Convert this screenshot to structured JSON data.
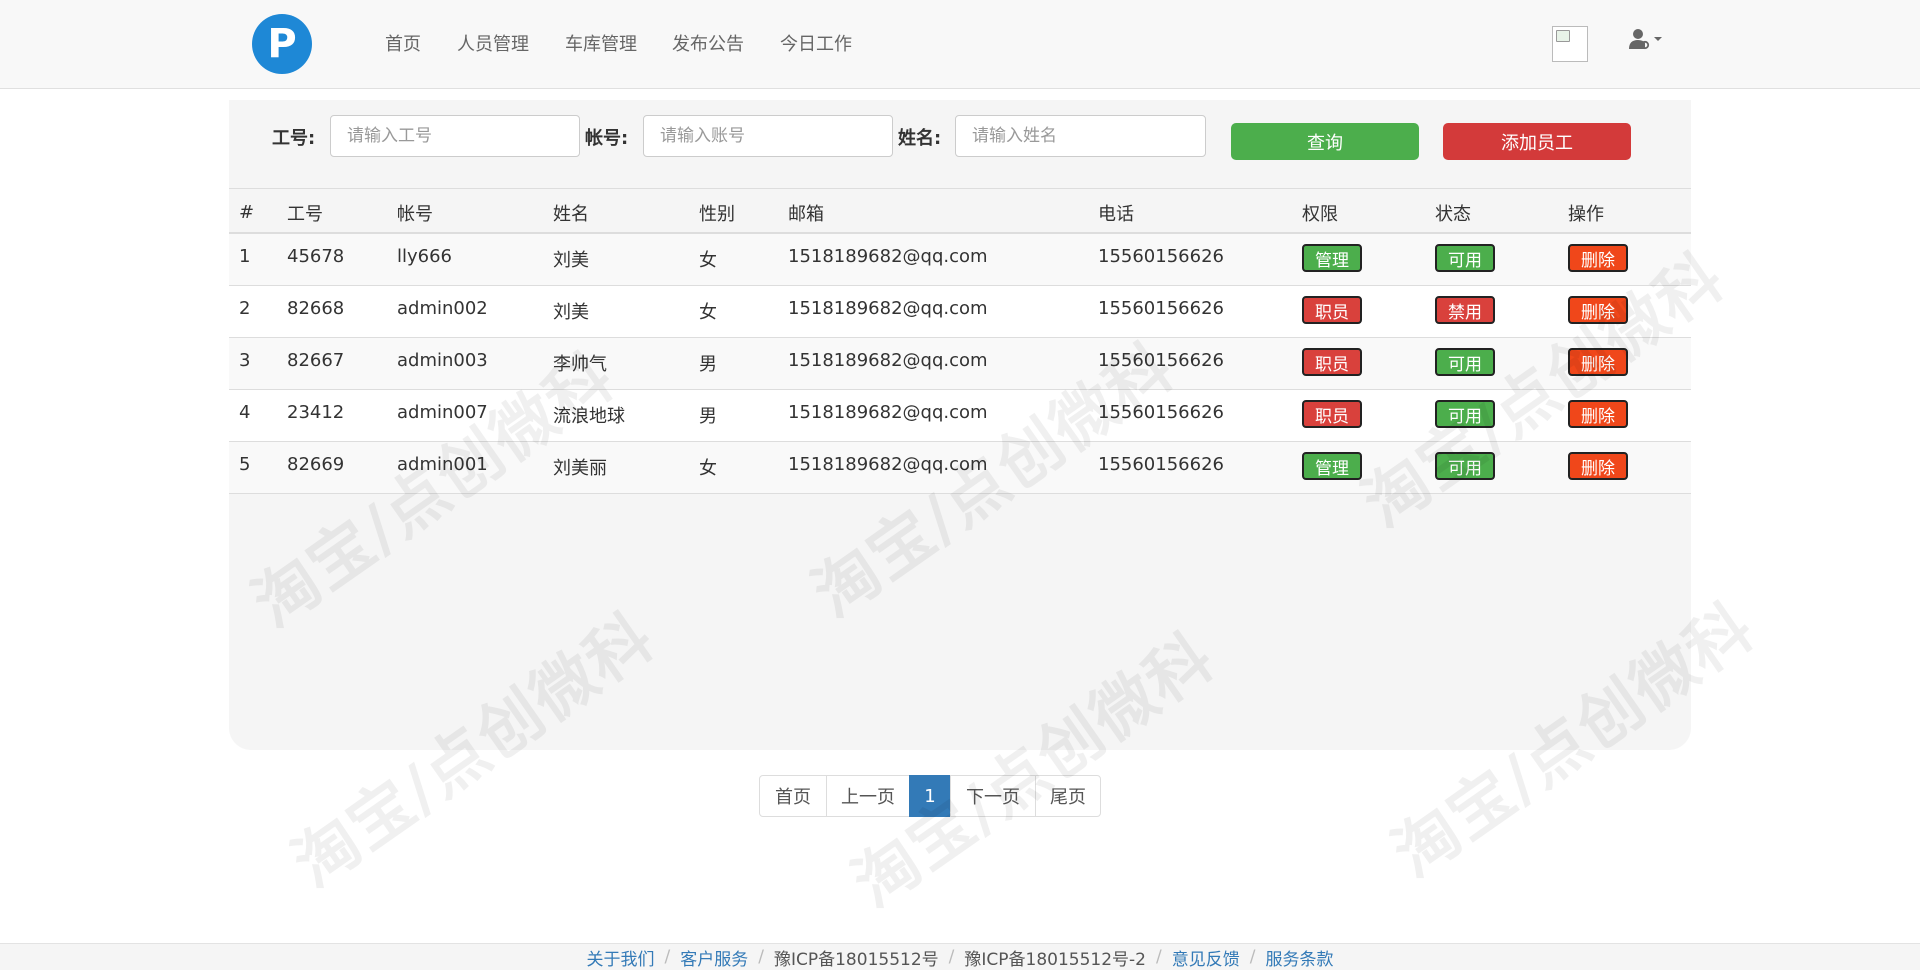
{
  "nav": {
    "logo_letter": "P",
    "items": [
      "首页",
      "人员管理",
      "车库管理",
      "发布公告",
      "今日工作"
    ]
  },
  "search": {
    "fields": [
      {
        "label": "工号:",
        "placeholder": "请输入工号"
      },
      {
        "label": "帐号:",
        "placeholder": "请输入账号"
      },
      {
        "label": "姓名:",
        "placeholder": "请输入姓名"
      }
    ],
    "query_label": "查询",
    "add_label": "添加员工"
  },
  "table": {
    "headers": [
      "#",
      "工号",
      "帐号",
      "姓名",
      "性别",
      "邮箱",
      "电话",
      "权限",
      "状态",
      "操作"
    ],
    "rows": [
      {
        "no": "1",
        "id": "45678",
        "account": "lly666",
        "name": "刘美",
        "gender": "女",
        "email": "1518189682@qq.com",
        "phone": "15560156626",
        "role": "管理",
        "role_color": "green",
        "status": "可用",
        "status_color": "green",
        "action": "删除"
      },
      {
        "no": "2",
        "id": "82668",
        "account": "admin002",
        "name": "刘美",
        "gender": "女",
        "email": "1518189682@qq.com",
        "phone": "15560156626",
        "role": "职员",
        "role_color": "red",
        "status": "禁用",
        "status_color": "red",
        "action": "删除"
      },
      {
        "no": "3",
        "id": "82667",
        "account": "admin003",
        "name": "李帅气",
        "gender": "男",
        "email": "1518189682@qq.com",
        "phone": "15560156626",
        "role": "职员",
        "role_color": "red",
        "status": "可用",
        "status_color": "green",
        "action": "删除"
      },
      {
        "no": "4",
        "id": "23412",
        "account": "admin007",
        "name": "流浪地球",
        "gender": "男",
        "email": "1518189682@qq.com",
        "phone": "15560156626",
        "role": "职员",
        "role_color": "red",
        "status": "可用",
        "status_color": "green",
        "action": "删除"
      },
      {
        "no": "5",
        "id": "82669",
        "account": "admin001",
        "name": "刘美丽",
        "gender": "女",
        "email": "1518189682@qq.com",
        "phone": "15560156626",
        "role": "管理",
        "role_color": "green",
        "status": "可用",
        "status_color": "green",
        "action": "删除"
      }
    ]
  },
  "pagination": {
    "first": "首页",
    "prev": "上一页",
    "current": "1",
    "next": "下一页",
    "last": "尾页"
  },
  "footer": {
    "items": [
      {
        "text": "关于我们",
        "link": true
      },
      {
        "text": "客户服务",
        "link": true
      },
      {
        "text": "豫ICP备18015512号",
        "link": false
      },
      {
        "text": "豫ICP备18015512号-2",
        "link": false
      },
      {
        "text": "意见反馈",
        "link": true
      },
      {
        "text": "服务条款",
        "link": true
      }
    ],
    "separator": "/"
  },
  "watermark": "淘宝/点创微科",
  "colors": {
    "green": "#4cae4c",
    "red": "#d9413c",
    "orange": "#f0471a",
    "primary": "#337ab7",
    "logo": "#1e88d6"
  }
}
